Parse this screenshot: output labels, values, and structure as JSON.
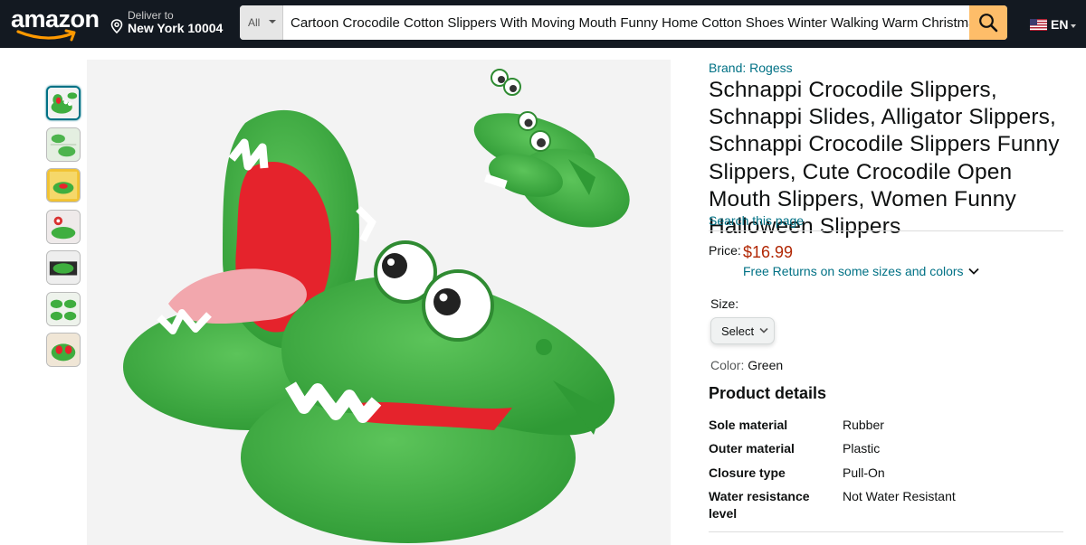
{
  "header": {
    "logo_text": "amazon",
    "deliver_line1": "Deliver to",
    "deliver_line2": "New York 10004",
    "search_category": "All",
    "search_value": "Cartoon Crocodile Cotton Slippers With Moving Mouth Funny Home Cotton Shoes Winter Walking Warm Christmas",
    "language": "EN",
    "icons": [
      "location-pin-icon",
      "search-icon",
      "us-flag-icon",
      "chevron-down-icon"
    ]
  },
  "gallery": {
    "thumbnail_count": 7,
    "active_index": 0,
    "share_icon": "share-icon"
  },
  "product": {
    "brand": "Brand: Rogess",
    "title": "Schnappi Crocodile Slippers, Schnappi Slides, Alligator Slippers, Schnappi Crocodile Slippers Funny Slippers, Cute Crocodile Open Mouth Slippers, Women Funny Halloween Slippers",
    "search_this_page": "Search this page",
    "price_label": "Price:",
    "price": "$16.99",
    "returns_text": "Free Returns on some sizes and colors",
    "size_label": "Size:",
    "size_selected": "Select",
    "color_label": "Color:",
    "color_value": "Green",
    "details_title": "Product details",
    "details": [
      {
        "label": "Sole material",
        "value": "Rubber"
      },
      {
        "label": "Outer material",
        "value": "Plastic"
      },
      {
        "label": "Closure type",
        "value": "Pull-On"
      },
      {
        "label": "Water resistance level",
        "value": "Not Water Resistant"
      }
    ]
  },
  "colors": {
    "header_bg": "#131921",
    "search_button": "#febd69",
    "link": "#007185",
    "price": "#b12704",
    "slipper_green": "#3fae3f"
  }
}
